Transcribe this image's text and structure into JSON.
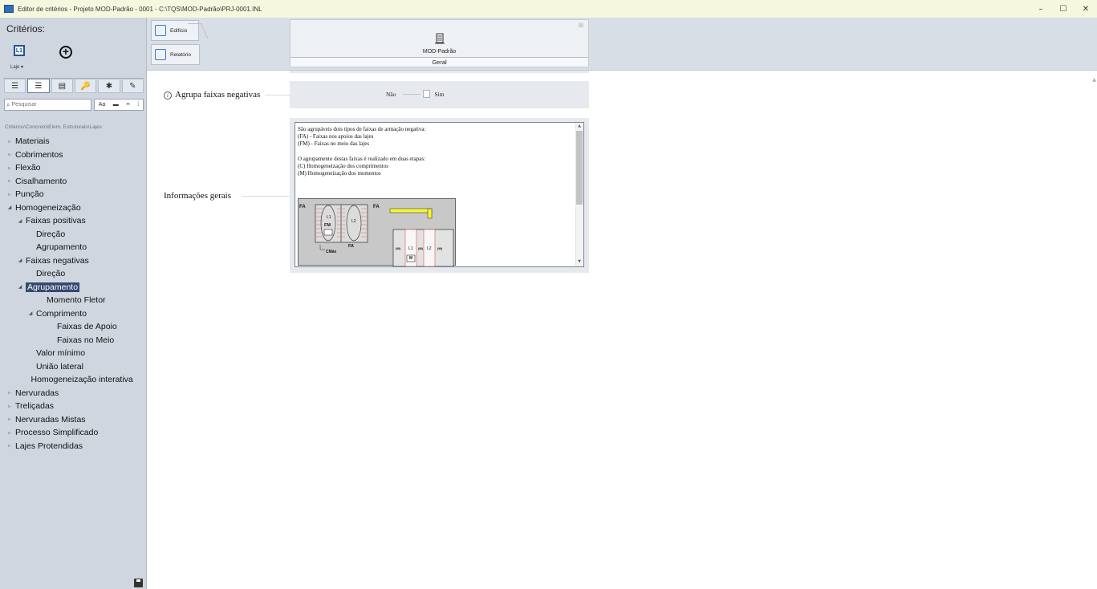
{
  "window": {
    "title": "Editor de critérios - Projeto MOD-Padrão - 0001 - C:\\TQS\\MOD-Padrão\\PRJ-0001.INL",
    "minimize": "–",
    "maximize": "☐",
    "close": "✕"
  },
  "sidebar": {
    "header": "Critérios:",
    "laje_icon_text": "L1",
    "laje_label": "Laje ▾",
    "add_symbol": "+",
    "toolbar_buttons": [
      "☰",
      "☰",
      "▤",
      "🔑",
      "✱",
      "✎"
    ],
    "search_placeholder": "Pesquisar",
    "search_tools": [
      "Aa",
      "▬",
      "❛❛",
      "⁞"
    ],
    "breadcrumb": "Critérios\\Concreto\\Elem. Estruturais\\Lajes",
    "tree": [
      {
        "label": "Materiais",
        "level": 0,
        "arrow": "▹"
      },
      {
        "label": "Cobrimentos",
        "level": 0,
        "arrow": "▹"
      },
      {
        "label": "Flexão",
        "level": 0,
        "arrow": "▹"
      },
      {
        "label": "Cisalhamento",
        "level": 0,
        "arrow": "▹"
      },
      {
        "label": "Punção",
        "level": 0,
        "arrow": "▹"
      },
      {
        "label": "Homogeneização",
        "level": 0,
        "arrow": "◢"
      },
      {
        "label": "Faixas positivas",
        "level": 1,
        "arrow": "◢"
      },
      {
        "label": "Direção",
        "level": 2,
        "arrow": ""
      },
      {
        "label": "Agrupamento",
        "level": 2,
        "arrow": ""
      },
      {
        "label": "Faixas negativas",
        "level": 1,
        "arrow": "◢"
      },
      {
        "label": "Direção",
        "level": 2,
        "arrow": ""
      },
      {
        "label": "Agrupamento",
        "level": 1,
        "arrow": "◢",
        "selected": true
      },
      {
        "label": "Momento Fletor",
        "level": 3,
        "arrow": ""
      },
      {
        "label": "Comprimento",
        "level": 2,
        "arrow": "◢"
      },
      {
        "label": "Faixas de Apoio",
        "level": 4,
        "arrow": ""
      },
      {
        "label": "Faixas no Meio",
        "level": 4,
        "arrow": ""
      },
      {
        "label": "Valor mínimo",
        "level": 2,
        "arrow": ""
      },
      {
        "label": "União lateral",
        "level": 2,
        "arrow": ""
      },
      {
        "label": "Homogeneização interativa",
        "level": 1.5,
        "arrow": ""
      },
      {
        "label": "Nervuradas",
        "level": 0,
        "arrow": "▹"
      },
      {
        "label": "Treliçadas",
        "level": 0,
        "arrow": "▹"
      },
      {
        "label": "Nervuradas Mistas",
        "level": 0,
        "arrow": "▹"
      },
      {
        "label": "Processo Simplificado",
        "level": 0,
        "arrow": "▹"
      },
      {
        "label": "Lajes Protendidas",
        "level": 0,
        "arrow": "▹"
      }
    ]
  },
  "topbar": {
    "edificio_label": "Edifício",
    "relatorio_label": "Relatório",
    "model_name": "MOD-Padrão",
    "model_tab": "Geral"
  },
  "main": {
    "agrupa_label": "Agrupa faixas negativas",
    "info_icon": "i",
    "toggle_no": "Não",
    "toggle_yes": "Sim",
    "info_label": "Informações gerais",
    "info_text": "São agrupáveis dois tipos de faixas de armação negativa:\n(FA) - Faixas nos apoios das lajes\n(FM) - Faixas no meio das lajes\n\nO agrupamento destas faixas é realizado em duas etapas:\n(C) Homogeneização dos comprimentos\n(M) Homogeneização dos momentos",
    "diagram_labels": {
      "fa": "FA",
      "l1": "L1",
      "l2": "L2",
      "fm": "FM",
      "cmax": "CMáx",
      "m": "M",
      "paren_m": "(M)"
    }
  },
  "colors": {
    "titlebar_bg": "#f6f8de",
    "sidebar_bg": "#cfd6e0",
    "selected_bg": "#34496f",
    "panel_bg": "#e6e9ee",
    "accent_blue": "#3a78c2"
  }
}
